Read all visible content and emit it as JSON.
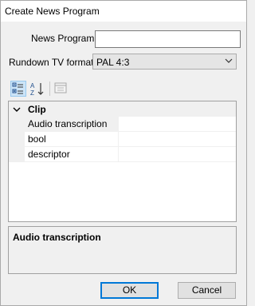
{
  "window": {
    "title": "Create News Program"
  },
  "form": {
    "news_program_label": "News Program",
    "news_program_value": "",
    "rundown_label": "Rundown TV format:",
    "rundown_value": "PAL 4:3"
  },
  "toolbar": {
    "categorized_icon": "categorized-view-icon",
    "alphabetical_icon": "sort-alphabetical-icon",
    "property_pages_icon": "property-pages-icon"
  },
  "grid": {
    "category": "Clip",
    "rows": [
      {
        "name": "Audio transcription",
        "value": ""
      },
      {
        "name": "bool",
        "value": ""
      },
      {
        "name": "descriptor",
        "value": ""
      }
    ]
  },
  "description": {
    "title": "Audio transcription"
  },
  "buttons": {
    "ok": "OK",
    "cancel": "Cancel"
  }
}
